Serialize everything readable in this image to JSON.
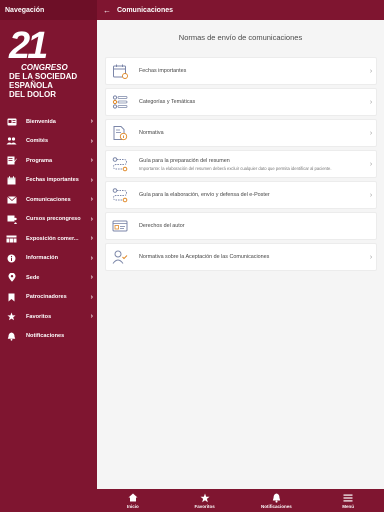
{
  "sidebar": {
    "header": "Navegación",
    "logo": {
      "number": "21",
      "lines": [
        "CONGRESO",
        "DE LA SOCIEDAD",
        "ESPAÑOLA",
        "DEL DOLOR"
      ]
    },
    "items": [
      {
        "label": "Bienvenida",
        "icon": "id-card-icon"
      },
      {
        "label": "Comités",
        "icon": "people-icon"
      },
      {
        "label": "Programa",
        "icon": "edit-note-icon"
      },
      {
        "label": "Fechas importantes",
        "icon": "calendar-icon"
      },
      {
        "label": "Comunicaciones",
        "icon": "envelope-icon"
      },
      {
        "label": "Cursos precongreso",
        "icon": "presentation-icon"
      },
      {
        "label": "Exposición comer...",
        "icon": "booths-icon"
      },
      {
        "label": "Información",
        "icon": "info-icon"
      },
      {
        "label": "Sede",
        "icon": "location-pin-icon"
      },
      {
        "label": "Patrocinadores",
        "icon": "bookmark-icon"
      },
      {
        "label": "Favoritos",
        "icon": "star-icon"
      },
      {
        "label": "Notificaciones",
        "icon": "bell-icon"
      }
    ]
  },
  "topbar": {
    "title": "Comunicaciones"
  },
  "content": {
    "title": "Normas de envío de comunicaciones",
    "items": [
      {
        "label": "Fechas importantes",
        "sub": "",
        "icon": "calendar-line-icon"
      },
      {
        "label": "Categorías y Temáticas",
        "sub": "",
        "icon": "list-categories-icon"
      },
      {
        "label": "Normativa",
        "sub": "",
        "icon": "document-info-icon"
      },
      {
        "label": "Guía para la preparación del resumen",
        "sub": "Importante: la elaboración del resumen deberá excluir cualquier dato que permita identificar al paciente.",
        "icon": "flow-route-icon"
      },
      {
        "label": "Guía para la elaboración, envío y defensa del e-Poster",
        "sub": "",
        "icon": "flow-route-icon"
      },
      {
        "label": "Derechos del autor",
        "sub": "",
        "icon": "id-card-line-icon"
      },
      {
        "label": "Normativa sobre la Aceptación de las Comunicaciones",
        "sub": "",
        "icon": "user-check-icon"
      }
    ]
  },
  "bottom": {
    "tabs": [
      {
        "label": "Inicio",
        "icon": "home-icon"
      },
      {
        "label": "Favoritos",
        "icon": "star-icon"
      },
      {
        "label": "Notificaciones",
        "icon": "bell-icon"
      },
      {
        "label": "Menú",
        "icon": "menu-icon"
      }
    ]
  },
  "colors": {
    "brand": "#7f1530",
    "background": "#f5f5f5"
  }
}
